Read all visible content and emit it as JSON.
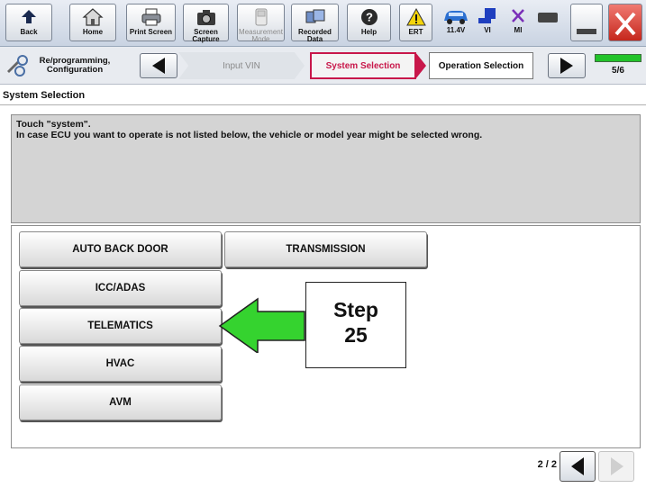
{
  "toolbar": {
    "back": "Back",
    "home": "Home",
    "print_screen": "Print Screen",
    "screen_capture": "Screen Capture",
    "measurement_mode": "Measurement Mode",
    "recorded_data": "Recorded Data",
    "help": "Help",
    "ert": "ERT",
    "voltage": "11.4V",
    "vi": "VI",
    "mi": "MI"
  },
  "nav": {
    "reprogramming": "Re/programming, Configuration",
    "input_vin": "Input VIN",
    "system_selection": "System Selection",
    "operation_selection": "Operation Selection",
    "step_counter": "5/6"
  },
  "section_title": "System Selection",
  "message": {
    "line1": "Touch \"system\".",
    "line2": "In case ECU you want to operate is not listed below, the vehicle or model year might be selected wrong."
  },
  "systems": {
    "auto_back_door": "AUTO BACK DOOR",
    "transmission": "TRANSMISSION",
    "icc_adas": "ICC/ADAS",
    "telematics": "TELEMATICS",
    "hvac": "HVAC",
    "avm": "AVM"
  },
  "pager": {
    "label": "2 / 2"
  },
  "callout": {
    "line1": "Step",
    "line2": "25"
  },
  "colors": {
    "accent": "#c8174a",
    "arrow_green": "#35d32f",
    "progress_green": "#22c32a"
  }
}
